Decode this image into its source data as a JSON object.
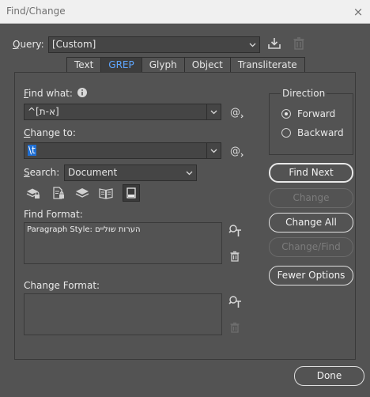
{
  "window": {
    "title": "Find/Change",
    "close_glyph": "×"
  },
  "query": {
    "label": "Query:",
    "value": "[Custom]"
  },
  "tabs": [
    {
      "label": "Text",
      "active": false
    },
    {
      "label": "GREP",
      "active": true
    },
    {
      "label": "Glyph",
      "active": false
    },
    {
      "label": "Object",
      "active": false
    },
    {
      "label": "Transliterate",
      "active": false
    }
  ],
  "find_what": {
    "label": "Find what:",
    "value": "^[א-ת]"
  },
  "change_to": {
    "label": "Change to:",
    "value": "\\t"
  },
  "search": {
    "label": "Search:",
    "value": "Document"
  },
  "find_format": {
    "label": "Find Format:",
    "value": "Paragraph Style: הערות שוליים"
  },
  "change_format": {
    "label": "Change Format:",
    "value": ""
  },
  "direction": {
    "title": "Direction",
    "options": [
      "Forward",
      "Backward"
    ],
    "selected": "Forward"
  },
  "buttons": {
    "find_next": "Find Next",
    "change": "Change",
    "change_all": "Change All",
    "change_find": "Change/Find",
    "fewer_options": "Fewer Options",
    "done": "Done"
  },
  "colors": {
    "background": "#535353",
    "active_tab": "#5ea6ff",
    "selection": "#1f6fd4"
  }
}
